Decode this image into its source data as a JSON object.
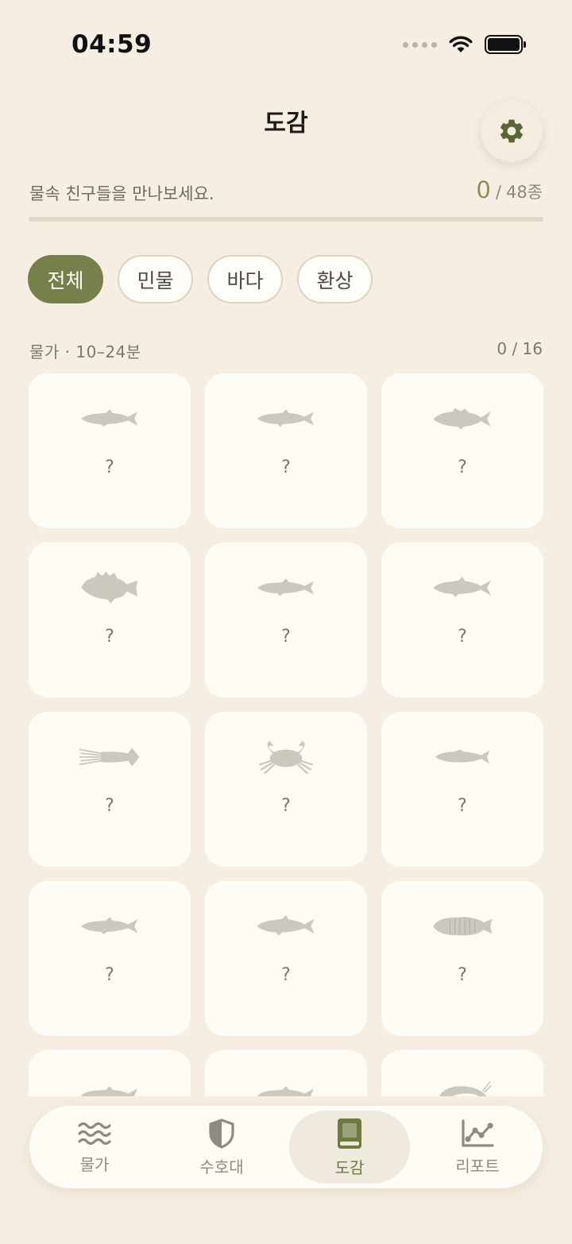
{
  "status_bar": {
    "time": "04:59"
  },
  "header": {
    "title": "도감"
  },
  "summary": {
    "subtitle": "물속 친구들을 만나보세요.",
    "collected": "0",
    "separator": "/",
    "total": "48종",
    "progress_fraction": 0
  },
  "filters": [
    {
      "label": "전체",
      "active": true
    },
    {
      "label": "민물",
      "active": false
    },
    {
      "label": "바다",
      "active": false
    },
    {
      "label": "환상",
      "active": false
    }
  ],
  "section": {
    "label": "물가 · 10–24분",
    "count": "0 / 16"
  },
  "cards": [
    {
      "icon": "slim-fish-icon",
      "label": "?"
    },
    {
      "icon": "slim-fish-icon",
      "label": "?"
    },
    {
      "icon": "spiny-fish-icon",
      "label": "?"
    },
    {
      "icon": "rockfish-icon",
      "label": "?"
    },
    {
      "icon": "slim-fish-icon",
      "label": "?"
    },
    {
      "icon": "trout-icon",
      "label": "?"
    },
    {
      "icon": "squid-icon",
      "label": "?"
    },
    {
      "icon": "crab-icon",
      "label": "?"
    },
    {
      "icon": "minnow-icon",
      "label": "?"
    },
    {
      "icon": "slim-fish-icon",
      "label": "?"
    },
    {
      "icon": "trout-icon",
      "label": "?"
    },
    {
      "icon": "striped-fish-icon",
      "label": "?"
    },
    {
      "icon": "slim-fish-icon",
      "label": "?"
    },
    {
      "icon": "slim-fish-icon",
      "label": "?"
    },
    {
      "icon": "shrimp-icon",
      "label": "?"
    }
  ],
  "tabs": [
    {
      "label": "물가",
      "icon": "waves-icon",
      "active": false
    },
    {
      "label": "수호대",
      "icon": "shield-icon",
      "active": false
    },
    {
      "label": "도감",
      "icon": "book-icon",
      "active": true
    },
    {
      "label": "리포트",
      "icon": "chart-icon",
      "active": false
    }
  ],
  "colors": {
    "background": "#f6eee3",
    "accent": "#75804a",
    "card": "#fffcf5",
    "silhouette": "#cdc8bd"
  }
}
